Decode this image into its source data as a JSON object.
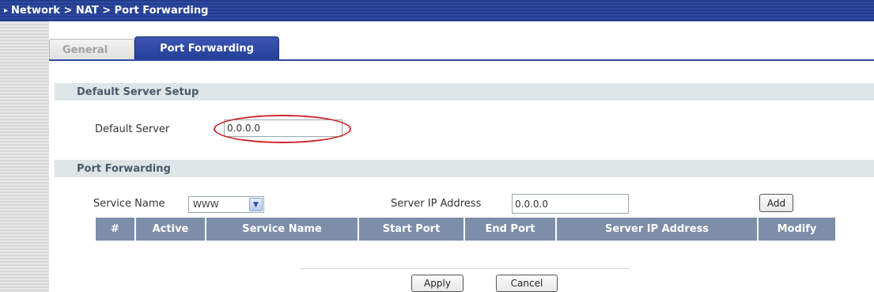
{
  "breadcrumb": {
    "text": "Network > NAT > Port Forwarding"
  },
  "tabs": [
    {
      "label": "General",
      "active": false
    },
    {
      "label": "Port Forwarding",
      "active": true
    }
  ],
  "default_server_section": {
    "header": "Default Server Setup",
    "label": "Default Server",
    "value": "0.0.0.0"
  },
  "port_forwarding_section": {
    "header": "Port Forwarding",
    "service_name_label": "Service Name",
    "service_name_value": "WWW",
    "server_ip_label": "Server IP Address",
    "server_ip_value": "0.0.0.0",
    "add_label": "Add"
  },
  "table": {
    "columns": [
      "#",
      "Active",
      "Service Name",
      "Start Port",
      "End Port",
      "Server IP Address",
      "Modify"
    ]
  },
  "actions": {
    "apply_label": "Apply",
    "cancel_label": "Cancel"
  },
  "colors": {
    "title_bar": "#2d49a0",
    "active_tab": "#2f4aa5",
    "section_header_bg": "#dde5e6",
    "table_header_bg": "#7d8ea8",
    "highlight_oval": "#d0262a"
  }
}
